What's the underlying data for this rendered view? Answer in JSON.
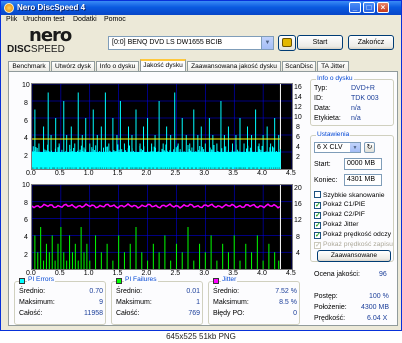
{
  "window": {
    "title": "Nero DiscSpeed 4",
    "controls": {
      "minimize": "_",
      "maximize": "□",
      "close": "×"
    }
  },
  "menu": [
    "Plik",
    "Uruchom test",
    "Dodatki",
    "Pomoc"
  ],
  "logo": {
    "top": "nero",
    "bottom_left": "DISC",
    "bottom_right": "SPEED"
  },
  "toolbar": {
    "drive": "[0:0]  BENQ DVD LS DW1655 BCIB",
    "start_label": "Start",
    "close_label": "Zakończ"
  },
  "tabs": [
    {
      "label": "Benchmark",
      "active": false
    },
    {
      "label": "Utwórz dysk",
      "active": false
    },
    {
      "label": "Info o dysku",
      "active": false
    },
    {
      "label": "Jakość dysku",
      "active": true
    },
    {
      "label": "Zaawansowana jakość dysku",
      "active": false
    },
    {
      "label": "ScanDisc",
      "active": false
    },
    {
      "label": "TA Jitter",
      "active": false
    }
  ],
  "colors": {
    "pie": "#00ffff",
    "pif": "#00ff00",
    "jitter": "#ff00ff",
    "speed": "#ffff00",
    "grid": "#0000ff",
    "bg": "#000000",
    "accent": "#0046d5"
  },
  "disc_info": {
    "title": "Info o dysku",
    "rows": [
      {
        "key": "Typ:",
        "value": "DVD+R"
      },
      {
        "key": "ID:",
        "value": "TDK 003"
      },
      {
        "key": "Data:",
        "value": "n/a"
      },
      {
        "key": "Etykieta:",
        "value": "n/a"
      }
    ]
  },
  "settings": {
    "title": "Ustawienia",
    "speed": "6 X CLV",
    "start_label": "Start:",
    "start_value": "0000 MB",
    "end_label": "Koniec:",
    "end_value": "4301 MB",
    "checkboxes": [
      {
        "label": "Szybkie skanowanie",
        "checked": false,
        "disabled": false
      },
      {
        "label": "Pokaż C1/PIE",
        "checked": true,
        "disabled": false
      },
      {
        "label": "Pokaż C2/PIF",
        "checked": true,
        "disabled": false
      },
      {
        "label": "Pokaż Jitter",
        "checked": true,
        "disabled": false
      },
      {
        "label": "Pokaż prędkość odczy",
        "checked": true,
        "disabled": false
      },
      {
        "label": "Pokaż prędkość zapisu",
        "checked": true,
        "disabled": true
      }
    ],
    "advanced_label": "Zaawansowane"
  },
  "quality": {
    "label": "Ocena jakości:",
    "value": "96"
  },
  "progress": {
    "rows": [
      {
        "key": "Postęp:",
        "value": "100 %"
      },
      {
        "key": "Położenie:",
        "value": "4300 MB"
      },
      {
        "key": "Prędkość:",
        "value": "6.04 X"
      }
    ]
  },
  "stats": {
    "pie": {
      "title": "PI Errors",
      "rows": [
        {
          "key": "Średnio:",
          "value": "0.70"
        },
        {
          "key": "Maksimum:",
          "value": "9"
        },
        {
          "key": "Całość:",
          "value": "11958"
        }
      ]
    },
    "pif": {
      "title": "PI Failures",
      "rows": [
        {
          "key": "Średnio:",
          "value": "0.01"
        },
        {
          "key": "Maksimum:",
          "value": "1"
        },
        {
          "key": "Całość:",
          "value": "769"
        }
      ]
    },
    "jitter": {
      "title": "Jitter",
      "rows": [
        {
          "key": "Średnio:",
          "value": "7.52 %"
        },
        {
          "key": "Maksimum:",
          "value": "8.5 %"
        },
        {
          "key": "Błędy PO:",
          "value": "0"
        }
      ]
    }
  },
  "chart_data": [
    {
      "type": "bar",
      "name": "PI Errors",
      "x_ticks": [
        "0.0",
        "0.5",
        "1.0",
        "1.5",
        "2.0",
        "2.5",
        "3.0",
        "3.5",
        "4.0",
        "4.5"
      ],
      "y_left_ticks": [
        "10",
        "8",
        "6",
        "4",
        "2"
      ],
      "y_right_ticks": [
        "16",
        "14",
        "12",
        "10",
        "8",
        "6",
        "4",
        "2"
      ],
      "xlim": [
        0,
        4.5
      ],
      "ylim": [
        0,
        10
      ],
      "y2lim": [
        0,
        17
      ],
      "data_extent_x": 4.3,
      "baseline_band": [
        0.2,
        2.0
      ],
      "spikes": [
        [
          0.05,
          7
        ],
        [
          0.12,
          3
        ],
        [
          0.2,
          5
        ],
        [
          0.28,
          9
        ],
        [
          0.33,
          4
        ],
        [
          0.41,
          6
        ],
        [
          0.47,
          3
        ],
        [
          0.55,
          8
        ],
        [
          0.6,
          4
        ],
        [
          0.68,
          5
        ],
        [
          0.74,
          3
        ],
        [
          0.8,
          9
        ],
        [
          0.87,
          4
        ],
        [
          0.93,
          6
        ],
        [
          1.0,
          3
        ],
        [
          1.06,
          7
        ],
        [
          1.13,
          4
        ],
        [
          1.2,
          5
        ],
        [
          1.27,
          9
        ],
        [
          1.33,
          3
        ],
        [
          1.4,
          6
        ],
        [
          1.47,
          4
        ],
        [
          1.53,
          8
        ],
        [
          1.6,
          3
        ],
        [
          1.67,
          5
        ],
        [
          1.73,
          4
        ],
        [
          1.8,
          7
        ],
        [
          1.87,
          3
        ],
        [
          1.93,
          5
        ],
        [
          2.0,
          6
        ],
        [
          2.07,
          3
        ],
        [
          2.13,
          4
        ],
        [
          2.2,
          8
        ],
        [
          2.27,
          3
        ],
        [
          2.33,
          5
        ],
        [
          2.4,
          4
        ],
        [
          2.47,
          9
        ],
        [
          2.53,
          3
        ],
        [
          2.6,
          6
        ],
        [
          2.67,
          4
        ],
        [
          2.73,
          3
        ],
        [
          2.8,
          7
        ],
        [
          2.87,
          4
        ],
        [
          2.93,
          5
        ],
        [
          3.0,
          3
        ],
        [
          3.07,
          6
        ],
        [
          3.13,
          4
        ],
        [
          3.2,
          3
        ],
        [
          3.27,
          8
        ],
        [
          3.33,
          4
        ],
        [
          3.4,
          5
        ],
        [
          3.47,
          3
        ],
        [
          3.53,
          4
        ],
        [
          3.6,
          6
        ],
        [
          3.67,
          3
        ],
        [
          3.73,
          5
        ],
        [
          3.8,
          4
        ],
        [
          3.87,
          7
        ],
        [
          3.93,
          3
        ],
        [
          4.0,
          4
        ],
        [
          4.07,
          5
        ],
        [
          4.13,
          3
        ],
        [
          4.2,
          6
        ],
        [
          4.27,
          4
        ]
      ],
      "speed_line": 6.0
    },
    {
      "type": "bar",
      "name": "PI Failures + Jitter",
      "x_ticks": [
        "0.0",
        "0.5",
        "1.0",
        "1.5",
        "2.0",
        "2.5",
        "3.0",
        "3.5",
        "4.0",
        "4.5"
      ],
      "y_left_ticks": [
        "10",
        "8",
        "6",
        "4",
        "2"
      ],
      "y_right_ticks": [
        "20",
        "16",
        "12",
        "8",
        "4"
      ],
      "xlim": [
        0,
        4.5
      ],
      "ylim": [
        0,
        10
      ],
      "y2lim": [
        0,
        20
      ],
      "data_extent_x": 4.3,
      "pif_spikes": [
        [
          0.05,
          4
        ],
        [
          0.1,
          2
        ],
        [
          0.15,
          5
        ],
        [
          0.2,
          1
        ],
        [
          0.25,
          3
        ],
        [
          0.3,
          2
        ],
        [
          0.35,
          4
        ],
        [
          0.4,
          1
        ],
        [
          0.45,
          3
        ],
        [
          0.5,
          5
        ],
        [
          0.55,
          2
        ],
        [
          0.6,
          1
        ],
        [
          0.65,
          4
        ],
        [
          0.7,
          2
        ],
        [
          0.75,
          3
        ],
        [
          0.8,
          1
        ],
        [
          0.85,
          5
        ],
        [
          0.9,
          2
        ],
        [
          0.95,
          3
        ],
        [
          1.0,
          1
        ],
        [
          1.1,
          4
        ],
        [
          1.2,
          2
        ],
        [
          1.3,
          3
        ],
        [
          1.4,
          1
        ],
        [
          1.5,
          4
        ],
        [
          1.6,
          2
        ],
        [
          1.7,
          3
        ],
        [
          1.8,
          5
        ],
        [
          1.9,
          2
        ],
        [
          2.0,
          1
        ],
        [
          2.1,
          3
        ],
        [
          2.2,
          2
        ],
        [
          2.3,
          4
        ],
        [
          2.4,
          1
        ],
        [
          2.5,
          3
        ],
        [
          2.6,
          2
        ],
        [
          2.7,
          5
        ],
        [
          2.8,
          1
        ],
        [
          2.9,
          3
        ],
        [
          3.0,
          2
        ],
        [
          3.1,
          4
        ],
        [
          3.2,
          1
        ],
        [
          3.3,
          3
        ],
        [
          3.4,
          2
        ],
        [
          3.5,
          4
        ],
        [
          3.6,
          1
        ],
        [
          3.7,
          3
        ],
        [
          3.8,
          2
        ],
        [
          3.9,
          4
        ],
        [
          4.0,
          1
        ],
        [
          4.1,
          3
        ],
        [
          4.2,
          2
        ],
        [
          4.27,
          1
        ]
      ],
      "jitter_line": 15.0
    }
  ],
  "caption": "645x525  51kb  PNG"
}
